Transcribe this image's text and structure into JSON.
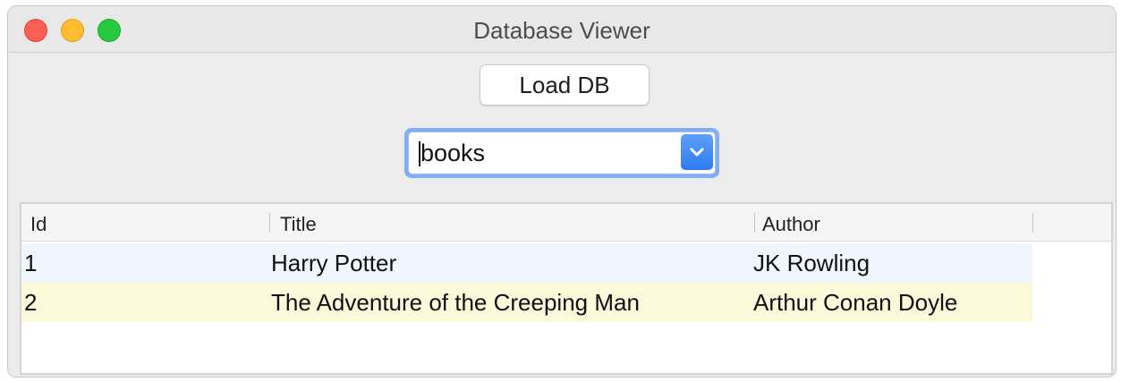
{
  "window": {
    "title": "Database Viewer"
  },
  "toolbar": {
    "load_label": "Load DB"
  },
  "table_selector": {
    "value": "books"
  },
  "table": {
    "columns": [
      "Id",
      "Title",
      "Author"
    ],
    "rows": [
      {
        "id": "1",
        "title": "Harry Potter",
        "author": "JK Rowling"
      },
      {
        "id": "2",
        "title": "The Adventure of the Creeping Man",
        "author": "Arthur Conan Doyle"
      }
    ]
  },
  "colors": {
    "close": "#fe5f57",
    "minimize": "#febc2e",
    "zoom": "#28c840",
    "focus_ring": "#7faef2",
    "row_1_bg": "#eff6fe",
    "row_2_bg": "#fcf8da"
  },
  "icons": {
    "dropdown": "chevron-down-icon"
  }
}
